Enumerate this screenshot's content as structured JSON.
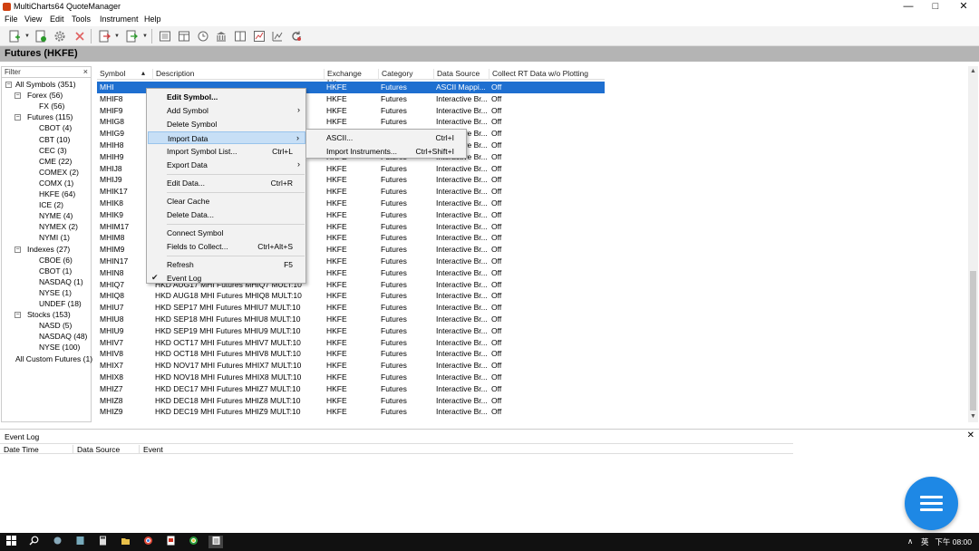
{
  "window": {
    "title": "MultiCharts64 QuoteManager",
    "min": "—",
    "max": "□",
    "close": "✕"
  },
  "menubar": [
    "File",
    "View",
    "Edit",
    "Tools",
    "Instrument",
    "Help"
  ],
  "section_title": "Futures (HKFE)",
  "filter": {
    "label": "Filter",
    "clear": "×"
  },
  "tree": [
    {
      "label": "All Symbols (351)",
      "level": 0,
      "exp": "−"
    },
    {
      "label": "Forex (56)",
      "level": 1,
      "exp": "−"
    },
    {
      "label": "FX (56)",
      "level": 2
    },
    {
      "label": "Futures (115)",
      "level": 1,
      "exp": "−"
    },
    {
      "label": "CBOT (4)",
      "level": 2
    },
    {
      "label": "CBT (10)",
      "level": 2
    },
    {
      "label": "CEC (3)",
      "level": 2
    },
    {
      "label": "CME (22)",
      "level": 2
    },
    {
      "label": "COMEX (2)",
      "level": 2
    },
    {
      "label": "COMX (1)",
      "level": 2
    },
    {
      "label": "HKFE (64)",
      "level": 2
    },
    {
      "label": "ICE (2)",
      "level": 2
    },
    {
      "label": "NYME (4)",
      "level": 2
    },
    {
      "label": "NYMEX (2)",
      "level": 2
    },
    {
      "label": "NYMI (1)",
      "level": 2
    },
    {
      "label": "Indexes (27)",
      "level": 1,
      "exp": "−"
    },
    {
      "label": "CBOE (6)",
      "level": 2
    },
    {
      "label": "CBOT (1)",
      "level": 2
    },
    {
      "label": "NASDAQ (1)",
      "level": 2
    },
    {
      "label": "NYSE (1)",
      "level": 2
    },
    {
      "label": "UNDEF (18)",
      "level": 2
    },
    {
      "label": "Stocks (153)",
      "level": 1,
      "exp": "−"
    },
    {
      "label": "NASD (5)",
      "level": 2
    },
    {
      "label": "NASDAQ (48)",
      "level": 2
    },
    {
      "label": "NYSE (100)",
      "level": 2
    },
    {
      "label": "All Custom Futures (1)",
      "level": 0
    }
  ],
  "columns": [
    "Symbol",
    "Description",
    "Exchange Lis...",
    "Category",
    "Data Source",
    "Collect RT Data w/o Plotting"
  ],
  "sort_indicator": "▴",
  "rows": [
    [
      "MHI",
      "",
      "HKFE",
      "Futures",
      "ASCII Mappi...",
      "Off"
    ],
    [
      "MHIF8",
      "",
      "HKFE",
      "Futures",
      "Interactive Br...",
      "Off"
    ],
    [
      "MHIF9",
      "",
      "HKFE",
      "Futures",
      "Interactive Br...",
      "Off"
    ],
    [
      "MHIG8",
      "",
      "HKFE",
      "Futures",
      "Interactive Br...",
      "Off"
    ],
    [
      "MHIG9",
      "",
      "HKFE",
      "Futures",
      "Interactive Br...",
      "Off"
    ],
    [
      "MHIH8",
      "",
      "HKFE",
      "Futures",
      "Interactive Br...",
      "Off"
    ],
    [
      "MHIH9",
      "",
      "HKFE",
      "Futures",
      "Interactive Br...",
      "Off"
    ],
    [
      "MHIJ8",
      "",
      "HKFE",
      "Futures",
      "Interactive Br...",
      "Off"
    ],
    [
      "MHIJ9",
      "",
      "HKFE",
      "Futures",
      "Interactive Br...",
      "Off"
    ],
    [
      "MHIK17",
      "",
      "HKFE",
      "Futures",
      "Interactive Br...",
      "Off"
    ],
    [
      "MHIK8",
      "",
      "HKFE",
      "Futures",
      "Interactive Br...",
      "Off"
    ],
    [
      "MHIK9",
      "",
      "HKFE",
      "Futures",
      "Interactive Br...",
      "Off"
    ],
    [
      "MHIM17",
      "",
      "HKFE",
      "Futures",
      "Interactive Br...",
      "Off"
    ],
    [
      "MHIM8",
      "",
      "HKFE",
      "Futures",
      "Interactive Br...",
      "Off"
    ],
    [
      "MHIM9",
      "",
      "HKFE",
      "Futures",
      "Interactive Br...",
      "Off"
    ],
    [
      "MHIN17",
      "",
      "HKFE",
      "Futures",
      "Interactive Br...",
      "Off"
    ],
    [
      "MHIN8",
      "",
      "HKFE",
      "Futures",
      "Interactive Br...",
      "Off"
    ],
    [
      "MHIQ7",
      "HKD AUG17 MHI Futures MHIQ7 MULT:10",
      "HKFE",
      "Futures",
      "Interactive Br...",
      "Off"
    ],
    [
      "MHIQ8",
      "HKD AUG18 MHI Futures MHIQ8 MULT:10",
      "HKFE",
      "Futures",
      "Interactive Br...",
      "Off"
    ],
    [
      "MHIU7",
      "HKD SEP17 MHI Futures MHIU7 MULT:10",
      "HKFE",
      "Futures",
      "Interactive Br...",
      "Off"
    ],
    [
      "MHIU8",
      "HKD SEP18 MHI Futures MHIU8 MULT:10",
      "HKFE",
      "Futures",
      "Interactive Br...",
      "Off"
    ],
    [
      "MHIU9",
      "HKD SEP19 MHI Futures MHIU9 MULT:10",
      "HKFE",
      "Futures",
      "Interactive Br...",
      "Off"
    ],
    [
      "MHIV7",
      "HKD OCT17 MHI Futures MHIV7 MULT:10",
      "HKFE",
      "Futures",
      "Interactive Br...",
      "Off"
    ],
    [
      "MHIV8",
      "HKD OCT18 MHI Futures MHIV8 MULT:10",
      "HKFE",
      "Futures",
      "Interactive Br...",
      "Off"
    ],
    [
      "MHIX7",
      "HKD NOV17 MHI Futures MHIX7 MULT:10",
      "HKFE",
      "Futures",
      "Interactive Br...",
      "Off"
    ],
    [
      "MHIX8",
      "HKD NOV18 MHI Futures MHIX8 MULT:10",
      "HKFE",
      "Futures",
      "Interactive Br...",
      "Off"
    ],
    [
      "MHIZ7",
      "HKD DEC17 MHI Futures MHIZ7 MULT:10",
      "HKFE",
      "Futures",
      "Interactive Br...",
      "Off"
    ],
    [
      "MHIZ8",
      "HKD DEC18 MHI Futures MHIZ8 MULT:10",
      "HKFE",
      "Futures",
      "Interactive Br...",
      "Off"
    ],
    [
      "MHIZ9",
      "HKD DEC19 MHI Futures MHIZ9 MULT:10",
      "HKFE",
      "Futures",
      "Interactive Br...",
      "Off"
    ]
  ],
  "context_menu": [
    {
      "label": "Edit Symbol...",
      "shortcut": "",
      "bold": true
    },
    {
      "label": "Add Symbol",
      "shortcut": "",
      "arrow": "›"
    },
    {
      "label": "Delete Symbol",
      "shortcut": ""
    },
    {
      "label": "Import Data",
      "shortcut": "",
      "arrow": "›",
      "highlight": true
    },
    {
      "label": "Import Symbol List...",
      "shortcut": "Ctrl+L"
    },
    {
      "label": "Export Data",
      "shortcut": "",
      "arrow": "›"
    },
    {
      "sep": true
    },
    {
      "label": "Edit Data...",
      "shortcut": "Ctrl+R"
    },
    {
      "sep": true
    },
    {
      "label": "Clear Cache",
      "shortcut": ""
    },
    {
      "label": "Delete Data...",
      "shortcut": ""
    },
    {
      "sep": true
    },
    {
      "label": "Connect Symbol",
      "shortcut": ""
    },
    {
      "label": "Fields to Collect...",
      "shortcut": "Ctrl+Alt+S"
    },
    {
      "sep": true
    },
    {
      "label": "Refresh",
      "shortcut": "F5"
    },
    {
      "label": "Event Log",
      "shortcut": "",
      "check": "✔"
    }
  ],
  "submenu": [
    {
      "label": "ASCII...",
      "shortcut": "Ctrl+I"
    },
    {
      "label": "Import Instruments...",
      "shortcut": "Ctrl+Shift+I"
    }
  ],
  "event_log": {
    "title": "Event Log",
    "close": "✕",
    "columns": [
      "Date Time",
      "Data Source",
      "Event"
    ]
  },
  "taskbar": {
    "tray_arrow": "∧",
    "ime": "英",
    "clock": "下午 08:00"
  },
  "colors": {
    "selection": "#1e6fd0",
    "header_bar": "#b4b4b4",
    "fab": "#1e88e5"
  }
}
